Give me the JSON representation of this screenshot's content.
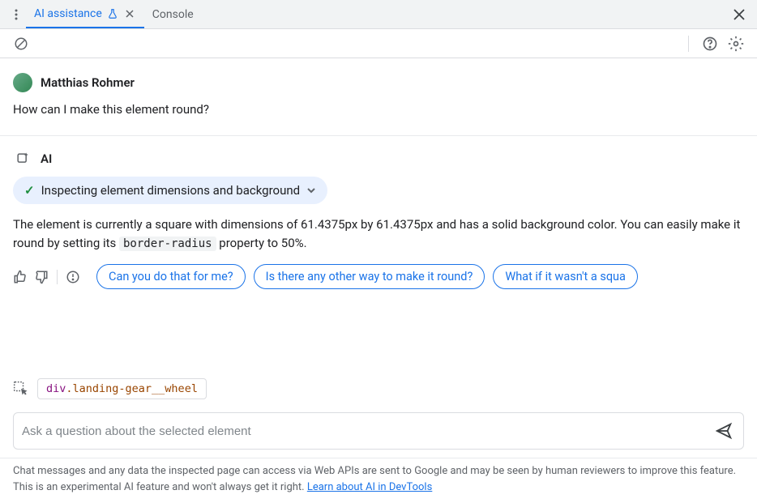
{
  "tabs": {
    "active": "AI assistance",
    "other": "Console"
  },
  "user": {
    "name": "Matthias Rohmer",
    "question": "How can I make this element round?"
  },
  "ai": {
    "label": "AI",
    "status": "Inspecting element dimensions and background",
    "response_prefix": "The element is currently a square with dimensions of 61.4375px by 61.4375px and has a solid background color. You can easily make it round by setting its ",
    "code_token": "border-radius",
    "response_suffix": " property to 50%.",
    "suggestions": [
      "Can you do that for me?",
      "Is there any other way to make it round?",
      "What if it wasn't a squa"
    ]
  },
  "context": {
    "tag": "div",
    "cls": ".landing-gear__wheel"
  },
  "input": {
    "placeholder": "Ask a question about the selected element"
  },
  "disclaimer": {
    "text": "Chat messages and any data the inspected page can access via Web APIs are sent to Google and may be seen by human reviewers to improve this feature. This is an experimental AI feature and won't always get it right. ",
    "link": "Learn about AI in DevTools"
  }
}
